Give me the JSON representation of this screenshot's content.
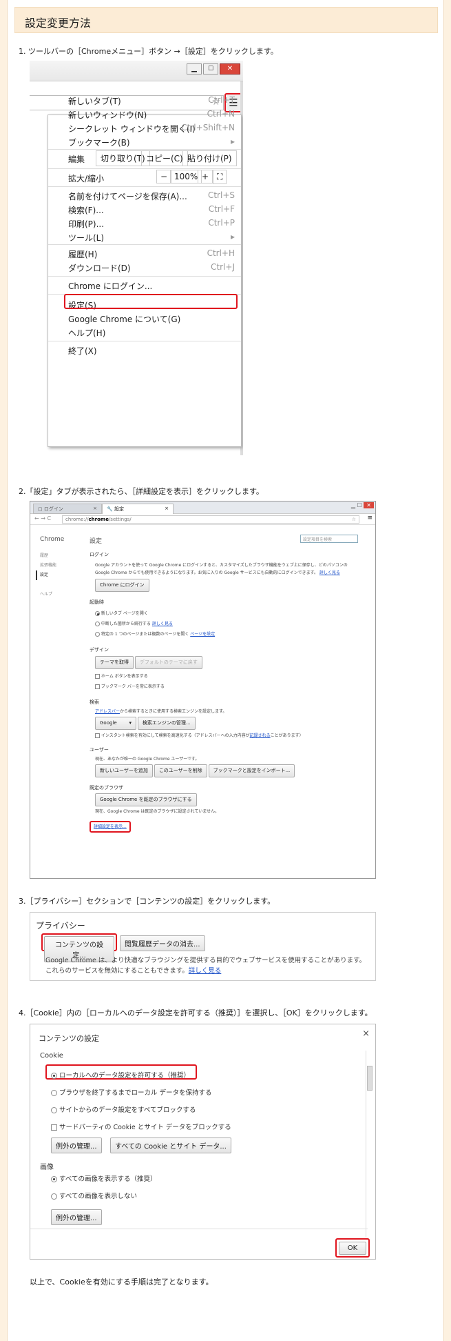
{
  "title": "設定変更方法",
  "steps": [
    "1. ツールバーの［Chromeメニュー］ボタン →［設定］をクリックします。",
    "2.「設定」タブが表示されたら、［詳細設定を表示］をクリックします。",
    "3.［プライバシー］セクションで［コンテンツの設定］をクリックします。",
    "4.［Cookie］内の［ローカルへのデータ設定を許可する（推奨）］を選択し、［OK］をクリックします。"
  ],
  "menu": {
    "items1": [
      {
        "label": "新しいタブ(T)",
        "shortcut": "Ctrl+T"
      },
      {
        "label": "新しいウィンドウ(N)",
        "shortcut": "Ctrl+N"
      },
      {
        "label": "シークレット ウィンドウを開く(I)",
        "shortcut": "Ctrl+Shift+N"
      },
      {
        "label": "ブックマーク(B)",
        "shortcut": "▸"
      }
    ],
    "edit_label": "編集",
    "cut": "切り取り(T)",
    "copy": "コピー(C)",
    "paste": "貼り付け(P)",
    "zoom_label": "拡大/縮小",
    "zoom_minus": "−",
    "zoom_value": "100%",
    "zoom_plus": "+",
    "fullscreen": "⛶",
    "items2": [
      {
        "label": "名前を付けてページを保存(A)...",
        "shortcut": "Ctrl+S"
      },
      {
        "label": "検索(F)...",
        "shortcut": "Ctrl+F"
      },
      {
        "label": "印刷(P)...",
        "shortcut": "Ctrl+P"
      },
      {
        "label": "ツール(L)",
        "shortcut": "▸"
      }
    ],
    "items3": [
      {
        "label": "履歴(H)",
        "shortcut": "Ctrl+H"
      },
      {
        "label": "ダウンロード(D)",
        "shortcut": "Ctrl+J"
      }
    ],
    "login": "Chrome にログイン...",
    "settings": "設定(S)",
    "about": "Google Chrome について(G)",
    "help": "ヘルプ(H)",
    "exit": "終了(X)"
  },
  "settings_page": {
    "tab1": "ログイン",
    "tab2": "設定",
    "url_prefix": "chrome://",
    "url_bold": "chrome",
    "url_suffix": "/settings/",
    "side_title": "Chrome",
    "side_items": [
      "履歴",
      "拡張機能",
      "設定",
      "",
      "ヘルプ"
    ],
    "heading": "設定",
    "search_placeholder": "設定項目を検索",
    "login_h": "ログイン",
    "login_text": "Google アカウントを使って Google Chrome にログインすると、カスタマイズしたブラウザ機能をウェブ上に保存し、どのパソコンの Google Chrome からでも使用できるようになります。お気に入りの Google サービスにも自動的にログインできます。",
    "more": "詳しく見る",
    "login_btn": "Chrome にログイン",
    "startup_h": "起動時",
    "startup_opts": [
      "新しいタブ ページを開く",
      "中断した箇所から続行する",
      "特定の 1 つのページまたは複数のページを開く"
    ],
    "startup_link": "ページを設定",
    "design_h": "デザイン",
    "theme_btn": "テーマを取得",
    "default_theme_btn": "デフォルトのテーマに戻す",
    "home_btn": "ホーム ボタンを表示する",
    "bookmark_bar": "ブックマーク バーを常に表示する",
    "search_h": "検索",
    "search_text_link": "アドレスバー",
    "search_text": "から検索するときに使用する検索エンジンを設定します。",
    "engine": "Google",
    "engine_manage": "検索エンジンの管理...",
    "instant": "インスタント検索を有効にして検索を高速化する（アドレスバーへの入力内容が",
    "instant_link": "記録される",
    "instant_end": "ことがあります）",
    "user_h": "ユーザー",
    "user_text": "現在、あなたが唯一の Google Chrome ユーザーです。",
    "add_user": "新しいユーザーを追加",
    "delete_user": "このユーザーを削除",
    "import": "ブックマークと設定をインポート...",
    "default_h": "既定のブラウザ",
    "default_btn": "Google Chrome を既定のブラウザにする",
    "default_text": "現在、Google Chrome は既定のブラウザに設定されていません。",
    "advanced": "詳細設定を表示..."
  },
  "privacy": {
    "heading": "プライバシー",
    "content_btn": "コンテンツの設定...",
    "clear_btn": "閲覧履歴データの消去...",
    "text": "Google Chrome は、より快適なブラウジングを提供する目的でウェブサービスを使用することがあります。これらのサービスを無効にすることもできます。",
    "more": "詳しく見る"
  },
  "content_dialog": {
    "title": "コンテンツの設定",
    "close": "×",
    "cookie_h": "Cookie",
    "cookie_opts": [
      "ローカルへのデータ設定を許可する（推奨）",
      "ブラウザを終了するまでローカル データを保持する",
      "サイトからのデータ設定をすべてブロックする"
    ],
    "third_party": "サードパーティの Cookie とサイト データをブロックする",
    "exceptions": "例外の管理...",
    "all_cookies": "すべての Cookie とサイト データ...",
    "image_h": "画像",
    "image_opts": [
      "すべての画像を表示する（推奨）",
      "すべての画像を表示しない"
    ],
    "image_exceptions": "例外の管理...",
    "ok": "OK"
  },
  "footer": "以上で、Cookieを有効にする手順は完了となります。"
}
